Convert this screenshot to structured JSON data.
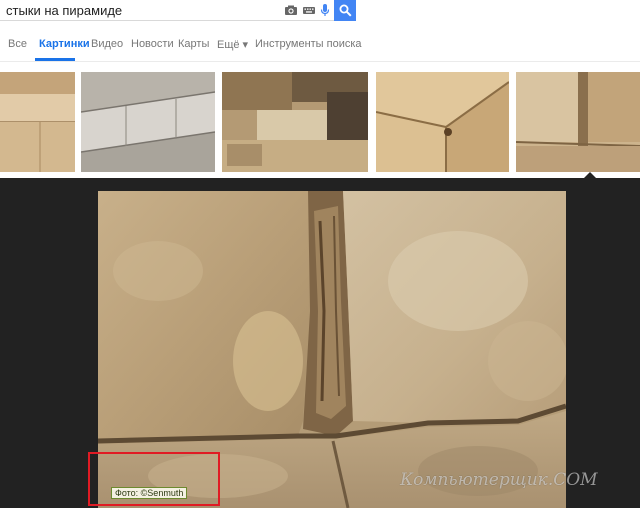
{
  "search": {
    "query": "стыки на пирамиде",
    "icons": [
      "camera-icon",
      "keyboard-icon",
      "microphone-icon",
      "search-icon"
    ]
  },
  "tabs": [
    {
      "label": "Все"
    },
    {
      "label": "Картинки",
      "active": true
    },
    {
      "label": "Видео"
    },
    {
      "label": "Новости"
    },
    {
      "label": "Карты"
    },
    {
      "label": "Ещё ▾"
    },
    {
      "label": "Инструменты поиска"
    }
  ],
  "colors": {
    "accent": "#1a73e8",
    "search_button": "#4285f4",
    "viewer_background": "#222222",
    "highlight_box": "#e01b24"
  },
  "preview": {
    "photo_credit": "Фото: ©Senmuth",
    "watermark": "Компьютерщик.COM"
  }
}
